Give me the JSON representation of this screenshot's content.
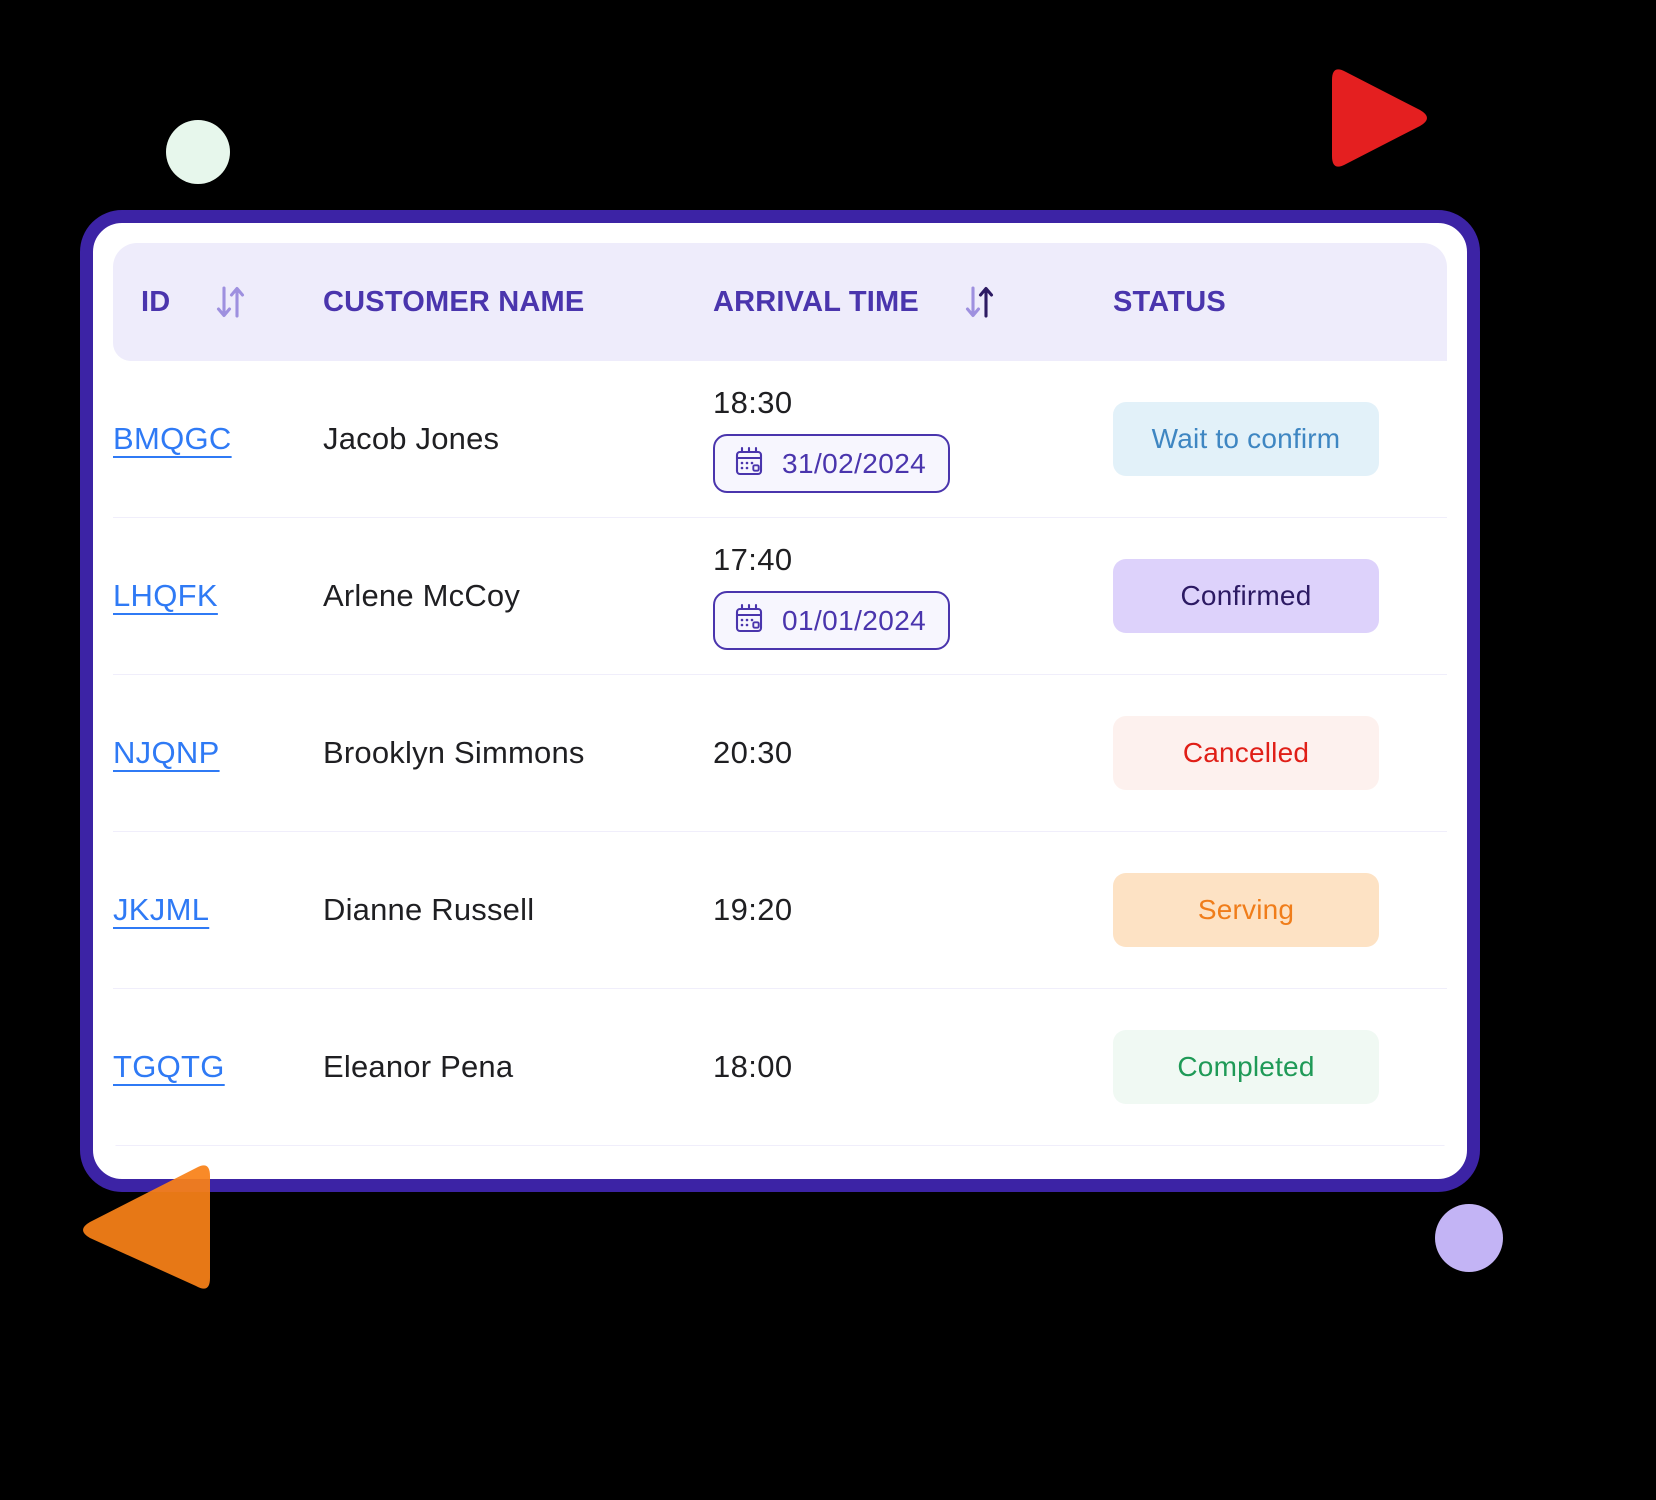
{
  "table": {
    "columns": [
      {
        "key": "id",
        "label": "ID",
        "sortable": true,
        "sort_state": "none"
      },
      {
        "key": "name",
        "label": "CUSTOMER NAME",
        "sortable": false,
        "sort_state": "none"
      },
      {
        "key": "time",
        "label": "ARRIVAL TIME",
        "sortable": true,
        "sort_state": "asc"
      },
      {
        "key": "status",
        "label": "STATUS",
        "sortable": false,
        "sort_state": "none"
      }
    ],
    "rows": [
      {
        "id": "BMQGC",
        "name": "Jacob Jones",
        "time": "18:30",
        "date": "31/02/2024",
        "has_date": true,
        "status": "Wait to confirm",
        "status_class": "badge-wait"
      },
      {
        "id": "LHQFK",
        "name": "Arlene McCoy",
        "time": "17:40",
        "date": "01/01/2024",
        "has_date": true,
        "status": "Confirmed",
        "status_class": "badge-confirmed"
      },
      {
        "id": "NJQNP",
        "name": "Brooklyn Simmons",
        "time": "20:30",
        "date": "",
        "has_date": false,
        "status": "Cancelled",
        "status_class": "badge-cancelled"
      },
      {
        "id": "JKJML",
        "name": "Dianne Russell",
        "time": "19:20",
        "date": "",
        "has_date": false,
        "status": "Serving",
        "status_class": "badge-serving"
      },
      {
        "id": "TGQTG",
        "name": "Eleanor Pena",
        "time": "18:00",
        "date": "",
        "has_date": false,
        "status": "Completed",
        "status_class": "badge-completed"
      }
    ]
  },
  "icons": {
    "sort": "sort-arrows-icon",
    "calendar": "calendar-icon"
  },
  "colors": {
    "card_border": "#3c23a5",
    "header_bg": "#eeecfb",
    "header_text": "#4a35ad",
    "id_link": "#2f7af5",
    "deco_green": "#e7f7ec",
    "deco_purple": "#c3b4f5",
    "deco_red": "#e41f20",
    "deco_orange": "#f98118",
    "status_wait": "#3e86c2",
    "status_confirmed": "#2c1a63",
    "status_cancelled": "#e01f17",
    "status_serving": "#f07d1a",
    "status_completed": "#1f9a57"
  }
}
